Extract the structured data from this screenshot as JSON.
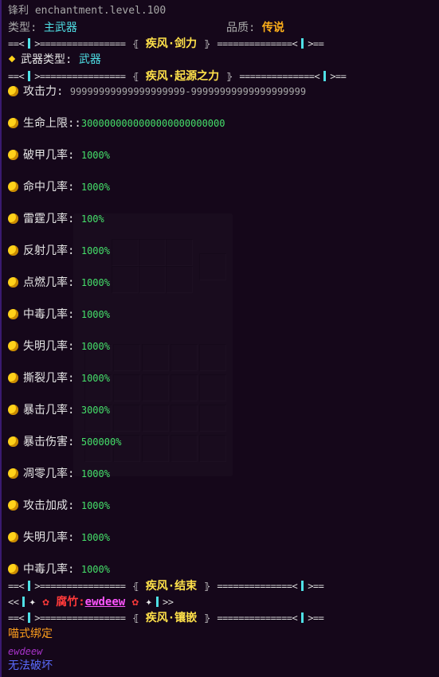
{
  "header": {
    "nbt_line": "锋利 enchantment.level.100",
    "type_label": "类型: ",
    "type_value": "主武器",
    "quality_label": "品质: ",
    "quality_value": "传说"
  },
  "sections": {
    "title1": "疾风·剑力",
    "weapon_type_label": "武器类型: ",
    "weapon_type_value": "武器",
    "title2": "疾风·起源之力",
    "title3": "疾风·结束",
    "title4": "疾风·镶嵌"
  },
  "separator": {
    "left": "==<|>===========",
    "right": "===========<|>==",
    "bracket_l": "⦃",
    "bracket_r": "⦄"
  },
  "attributes": [
    {
      "label": "攻击力: ",
      "value": "99999999999999999999-99999999999999999999",
      "color": "#a8a8a8"
    },
    {
      "label": "生命上限::",
      "value": "3000000000000000000000000",
      "color": "#45e06a"
    },
    {
      "label": "破甲几率: ",
      "value": "1000%",
      "color": "#45e06a"
    },
    {
      "label": "命中几率: ",
      "value": "1000%",
      "color": "#45e06a"
    },
    {
      "label": "雷霆几率: ",
      "value": "100%",
      "color": "#45e06a"
    },
    {
      "label": "反射几率: ",
      "value": "1000%",
      "color": "#45e06a"
    },
    {
      "label": "点燃几率: ",
      "value": "1000%",
      "color": "#45e06a"
    },
    {
      "label": "中毒几率: ",
      "value": "1000%",
      "color": "#45e06a"
    },
    {
      "label": "失明几率: ",
      "value": "1000%",
      "color": "#45e06a"
    },
    {
      "label": "撕裂几率: ",
      "value": "1000%",
      "color": "#45e06a"
    },
    {
      "label": "暴击几率: ",
      "value": "3000%",
      "color": "#45e06a"
    },
    {
      "label": "暴击伤害: ",
      "value": "500000%",
      "color": "#45e06a"
    },
    {
      "label": "凋零几率: ",
      "value": "1000%",
      "color": "#45e06a"
    },
    {
      "label": "攻击加成: ",
      "value": "1000%",
      "color": "#45e06a"
    },
    {
      "label": "失明几率: ",
      "value": "1000%",
      "color": "#45e06a"
    },
    {
      "label": "中毒几率: ",
      "value": "1000%",
      "color": "#45e06a"
    }
  ],
  "owner": {
    "prefix": "<<",
    "name_label": "腐竹:",
    "name_value": "ewdeew",
    "suffix": ">>"
  },
  "footer": {
    "bound": "喵式绑定",
    "player": "ewdeew",
    "unbreakable": "无法破坏"
  },
  "colors": {
    "accent_cyan": "#4fe0e6",
    "legendary_gold": "#ffb01a",
    "title_yellow": "#ffe14a",
    "value_green": "#45e06a",
    "border_purple": "#3a1a70"
  }
}
